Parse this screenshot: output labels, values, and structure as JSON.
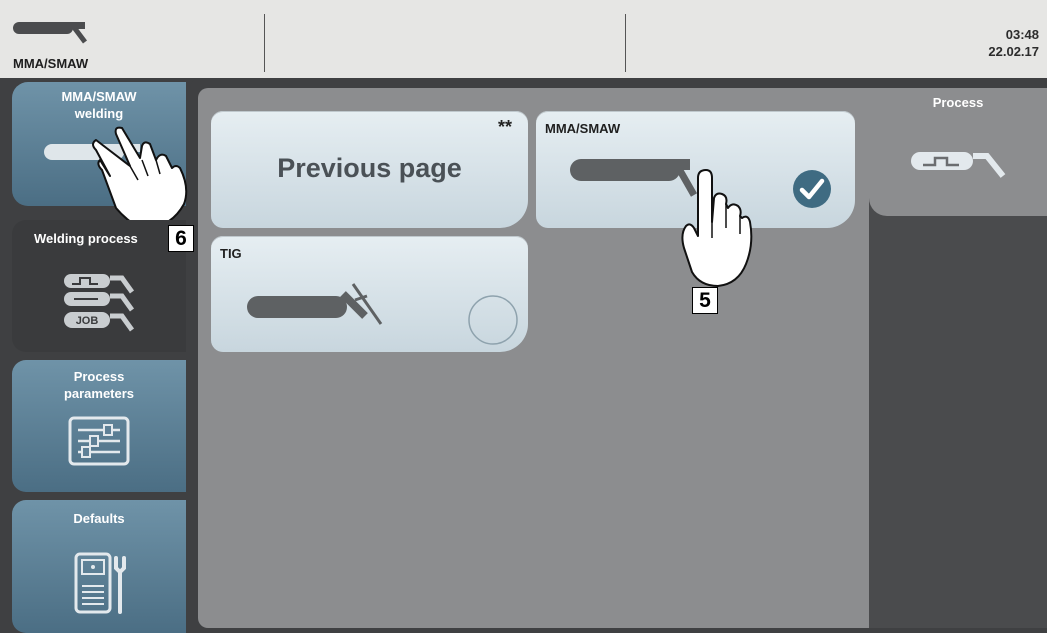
{
  "header": {
    "mode_label": "MMA/SMAW",
    "time": "03:48",
    "date": "22.02.17"
  },
  "sidebar": {
    "items": [
      {
        "label_line1": "MMA/SMAW",
        "label_line2": "welding",
        "icon": "mma-electrode-icon"
      },
      {
        "label": "Welding process",
        "icon": "welding-process-icon",
        "job_label": "JOB"
      },
      {
        "label_line1": "Process",
        "label_line2": "parameters",
        "icon": "sliders-icon"
      },
      {
        "label": "Defaults",
        "icon": "machine-wrench-icon"
      }
    ]
  },
  "main": {
    "cards": [
      {
        "id": "previous",
        "label": "Previous page",
        "marker": "**"
      },
      {
        "id": "mma",
        "label": "MMA/SMAW",
        "selected": true,
        "icon": "mma-electrode-icon"
      },
      {
        "id": "tig",
        "label": "TIG",
        "selected": false,
        "icon": "tig-torch-icon"
      }
    ]
  },
  "right_panel": {
    "tab_label": "Process",
    "icon": "process-pulse-icon"
  },
  "callouts": {
    "step5": "5",
    "step6": "6"
  },
  "colors": {
    "accent": "#3f6b82",
    "card": "#d6e2e8",
    "frame": "#3f4042"
  }
}
